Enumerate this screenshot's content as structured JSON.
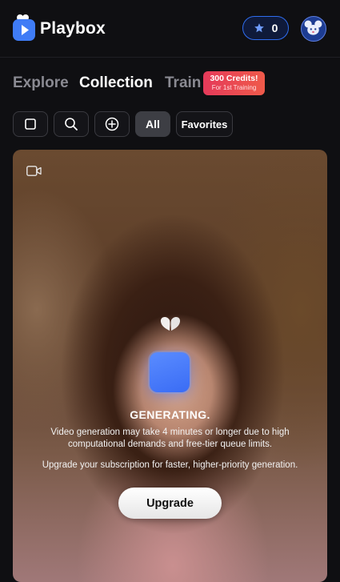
{
  "header": {
    "brand": "Playbox",
    "credits_count": "0",
    "icons": {
      "logo": "playbox-logo-icon",
      "credits": "star-icon",
      "avatar": "mouse-avatar"
    }
  },
  "tabs": {
    "explore": "Explore",
    "collection": "Collection",
    "train": "Train",
    "active": "Collection",
    "promo": {
      "line1": "300 Credits!",
      "line2": "For 1st Training"
    }
  },
  "toolbar": {
    "icons": [
      "select-square-icon",
      "search-icon",
      "add-circle-icon"
    ],
    "filter_all": "All",
    "filter_favorites": "Favorites",
    "active_filter": "All"
  },
  "card": {
    "type_icon": "video-camera-icon",
    "status_title": "GENERATING.",
    "description": "Video generation may take 4 minutes or longer due to high computational demands and free-tier queue limits.",
    "upsell": "Upgrade your subscription for faster, higher-priority generation.",
    "upgrade_label": "Upgrade"
  },
  "colors": {
    "background": "#0f0f12",
    "accent_blue": "#2f6df0",
    "promo_red": "#e53a5a",
    "spinner_blue": "#4a7cff"
  }
}
